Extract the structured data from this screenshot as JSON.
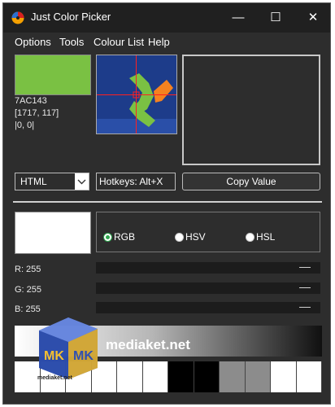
{
  "window": {
    "title": "Just Color Picker",
    "controls": {
      "minimize": "—",
      "maximize": "☐",
      "close": "✕"
    }
  },
  "menu": [
    "Options",
    "Tools",
    "Colour List",
    "Help"
  ],
  "picker": {
    "hex": "7AC143",
    "position": "[1717, 117]",
    "offset": "|0, 0|",
    "swatch_color": "#7AC143"
  },
  "format": {
    "selected": "HTML",
    "hotkeys": "Hotkeys: Alt+X",
    "copy_label": "Copy Value"
  },
  "modes": {
    "options": [
      "RGB",
      "HSV",
      "HSL"
    ],
    "selected": "RGB"
  },
  "channels": [
    {
      "label": "R: 255",
      "value": 255
    },
    {
      "label": "G: 255",
      "value": 255
    },
    {
      "label": "B: 255",
      "value": 255
    }
  ],
  "palette": [
    "#ffffff",
    "#ffffff",
    "#ffffff",
    "#ffffff",
    "#ffffff",
    "#ffffff",
    "#000000",
    "#000000",
    "#8c8c8c",
    "#8c8c8c",
    "#ffffff",
    "#ffffff"
  ],
  "watermark": {
    "logo_letters": "MK",
    "text": "mediaket.net",
    "small_text": "mediaket.net"
  }
}
